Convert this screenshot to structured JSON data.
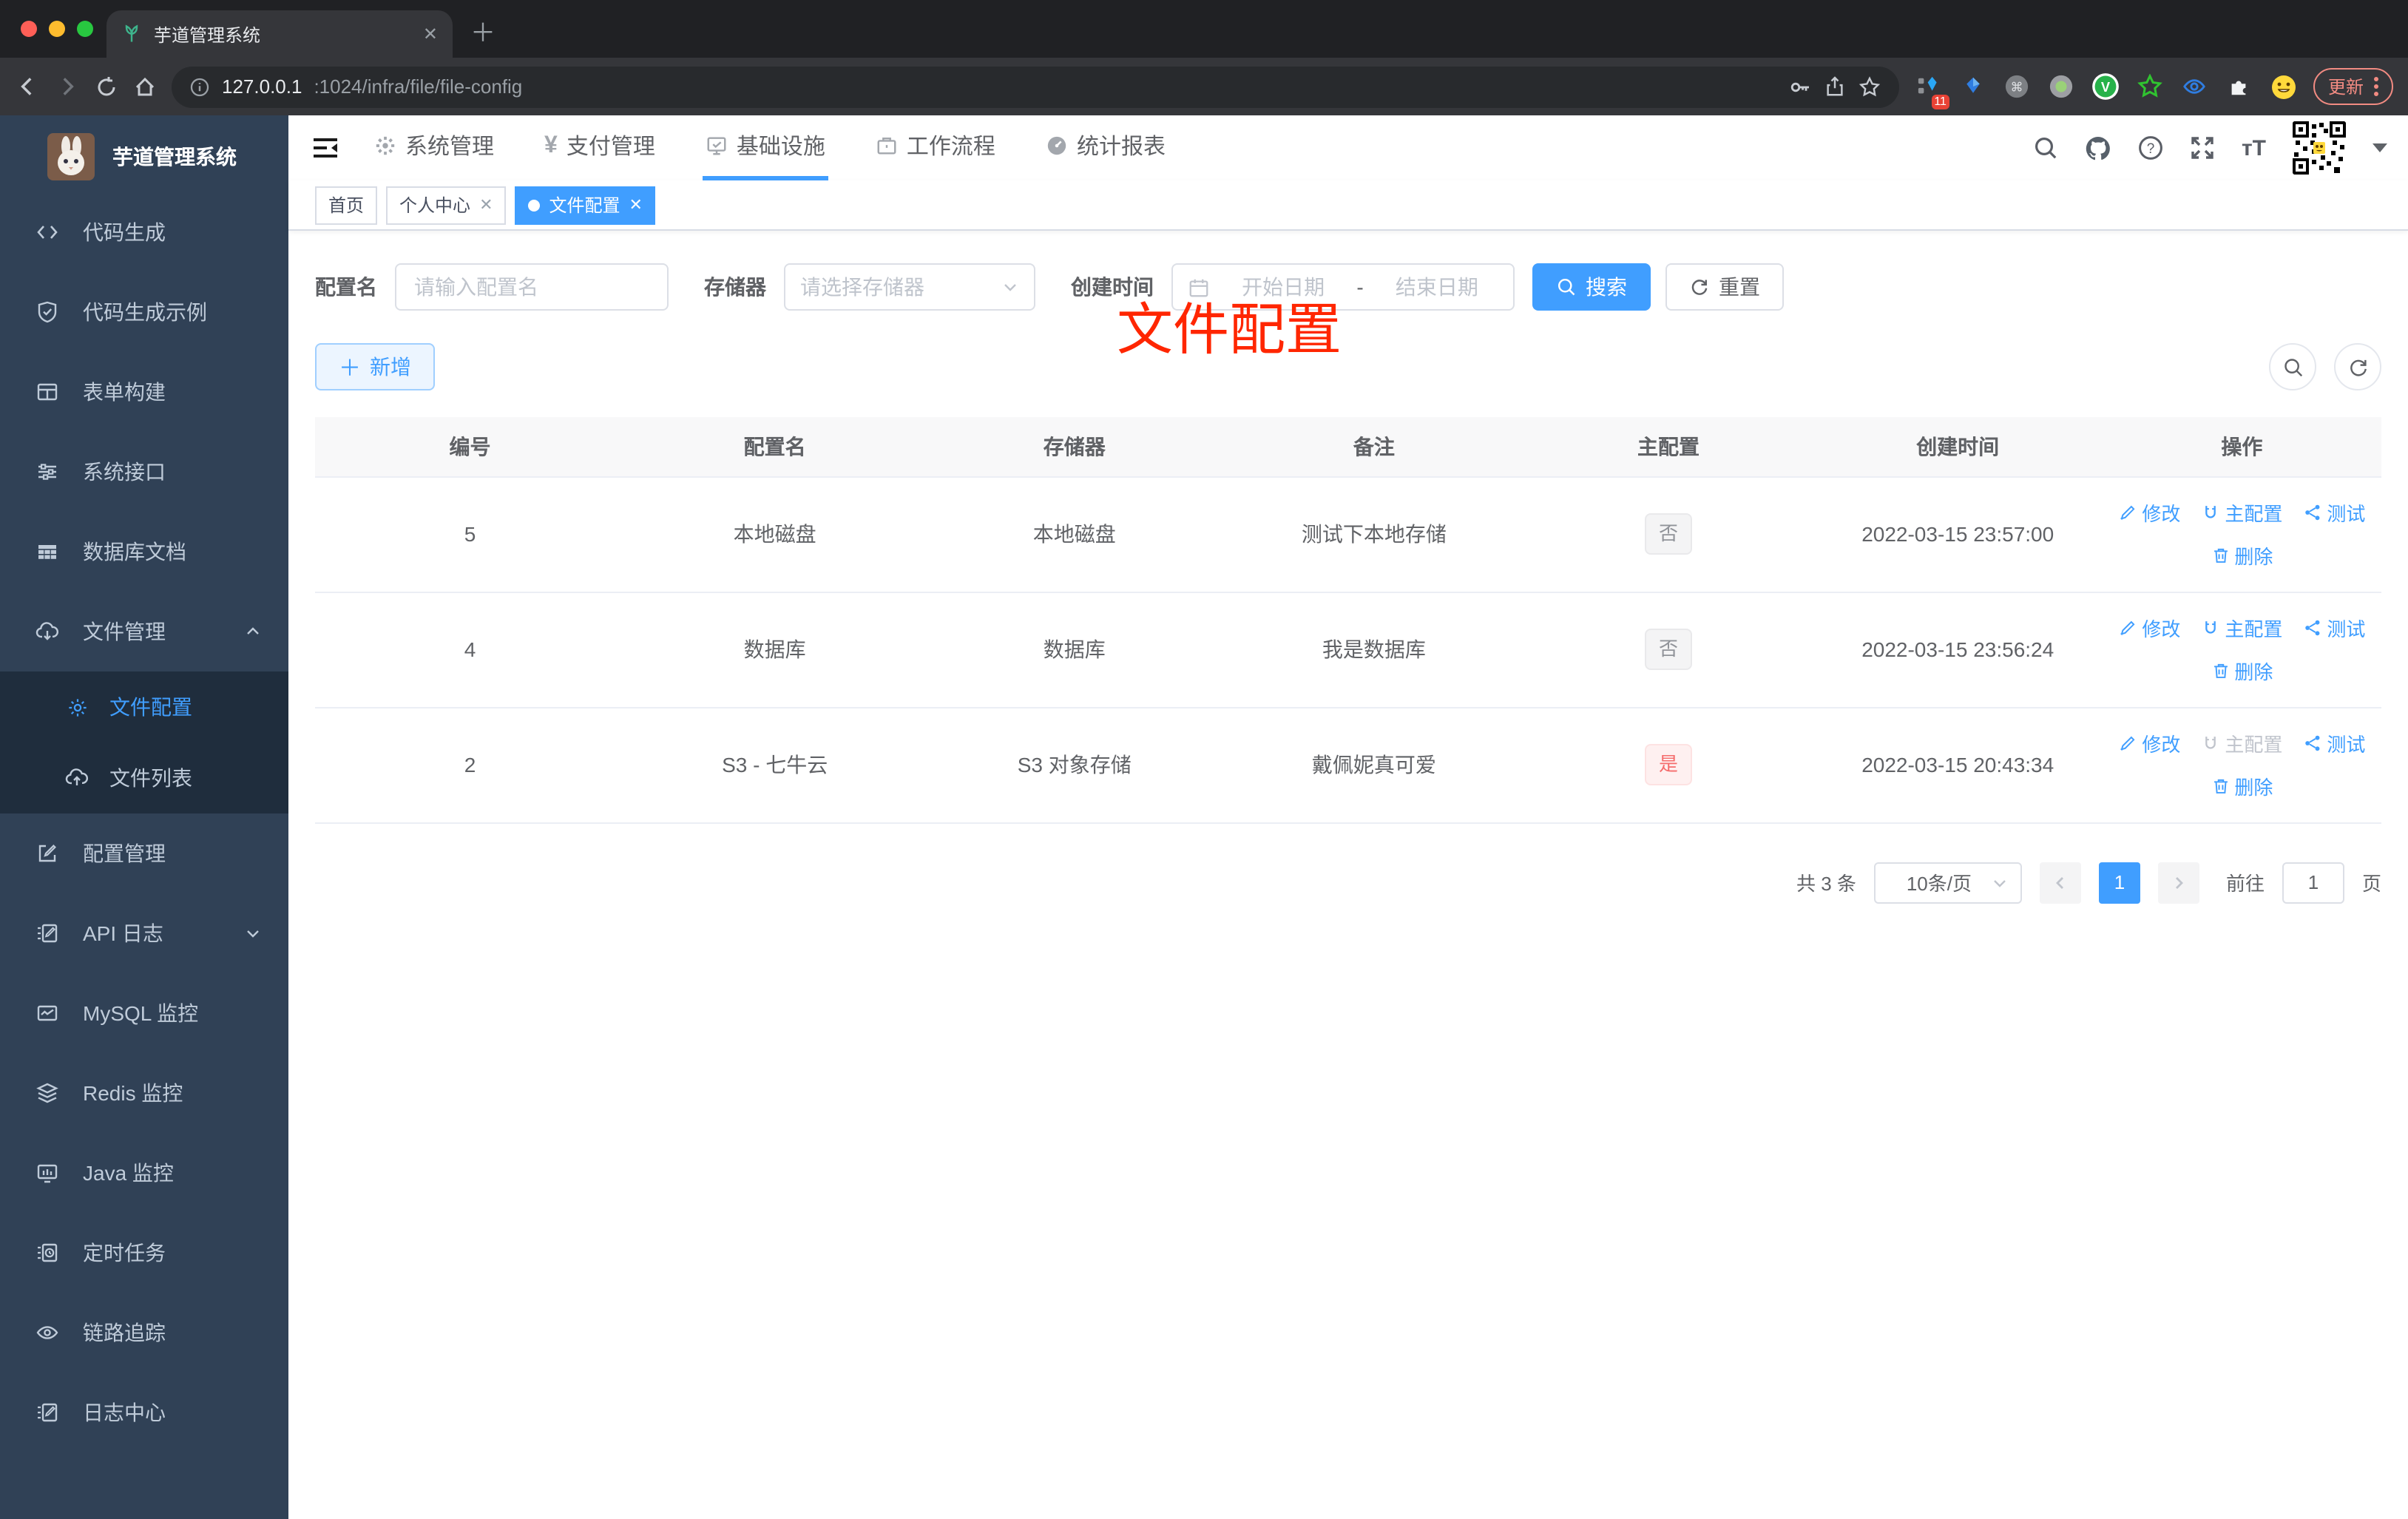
{
  "browser": {
    "tab_title": "芋道管理系统",
    "url_host": "127.0.0.1",
    "url_rest": ":1024/infra/file/file-config",
    "ext_badge": "11",
    "update_label": "更新"
  },
  "sidebar": {
    "logo_title": "芋道管理系统",
    "items": [
      {
        "label": "代码生成",
        "icon": "code-icon"
      },
      {
        "label": "代码生成示例",
        "icon": "shield-check-icon"
      },
      {
        "label": "表单构建",
        "icon": "form-builder-icon"
      },
      {
        "label": "系统接口",
        "icon": "sliders-icon"
      },
      {
        "label": "数据库文档",
        "icon": "database-doc-icon"
      },
      {
        "label": "文件管理",
        "icon": "cloud-download-icon",
        "expanded": true
      },
      {
        "label": "文件配置",
        "icon": "gear-icon",
        "active": true
      },
      {
        "label": "文件列表",
        "icon": "cloud-upload-icon"
      },
      {
        "label": "配置管理",
        "icon": "edit-square-icon"
      },
      {
        "label": "API 日志",
        "icon": "log-doc-icon",
        "collapsed": true
      },
      {
        "label": "MySQL 监控",
        "icon": "chart-monitor-icon"
      },
      {
        "label": "Redis 监控",
        "icon": "layers-icon"
      },
      {
        "label": "Java 监控",
        "icon": "java-monitor-icon"
      },
      {
        "label": "定时任务",
        "icon": "schedule-icon"
      },
      {
        "label": "链路追踪",
        "icon": "trace-eye-icon"
      },
      {
        "label": "日志中心",
        "icon": "log-center-icon"
      }
    ]
  },
  "header": {
    "nav": [
      {
        "label": "系统管理",
        "icon": "gear-icon"
      },
      {
        "label": "支付管理",
        "icon": "yen-icon"
      },
      {
        "label": "基础设施",
        "icon": "infra-monitor-icon",
        "active": true
      },
      {
        "label": "工作流程",
        "icon": "briefcase-icon"
      },
      {
        "label": "统计报表",
        "icon": "dashboard-icon"
      }
    ]
  },
  "tabs": [
    {
      "label": "首页"
    },
    {
      "label": "个人中心",
      "closable": true
    },
    {
      "label": "文件配置",
      "active": true,
      "closable": true
    }
  ],
  "annotation": "文件配置",
  "filters": {
    "name_label": "配置名",
    "name_placeholder": "请输入配置名",
    "storage_label": "存储器",
    "storage_placeholder": "请选择存储器",
    "time_label": "创建时间",
    "start_placeholder": "开始日期",
    "range_separator": "-",
    "end_placeholder": "结束日期",
    "search_label": "搜索",
    "reset_label": "重置"
  },
  "toolbar": {
    "add_label": "新增"
  },
  "table": {
    "columns": [
      "编号",
      "配置名",
      "存储器",
      "备注",
      "主配置",
      "创建时间",
      "操作"
    ],
    "row_actions": {
      "edit": "修改",
      "master": "主配置",
      "test": "测试",
      "remove": "删除"
    },
    "rows": [
      {
        "id": "5",
        "name": "本地磁盘",
        "storage": "本地磁盘",
        "remark": "测试下本地存储",
        "master_label": "否",
        "master_type": "info",
        "created": "2022-03-15 23:57:00",
        "master_disabled": false
      },
      {
        "id": "4",
        "name": "数据库",
        "storage": "数据库",
        "remark": "我是数据库",
        "master_label": "否",
        "master_type": "info",
        "created": "2022-03-15 23:56:24",
        "master_disabled": false
      },
      {
        "id": "2",
        "name": "S3 - 七牛云",
        "storage": "S3 对象存储",
        "remark": "戴佩妮真可爱",
        "master_label": "是",
        "master_type": "danger",
        "created": "2022-03-15 20:43:34",
        "master_disabled": true
      }
    ]
  },
  "pagination": {
    "total": "共 3 条",
    "page_size": "10条/页",
    "current_page": "1",
    "goto_label": "前往",
    "goto_value": "1",
    "unit_label": "页"
  },
  "colors": {
    "accent": "#409eff",
    "danger": "#f56c6c",
    "sidebar_bg": "#304156",
    "submenu_bg": "#1f2d3d",
    "annotation": "#ff2600",
    "chrome_bg": "#202124",
    "toolbar_bg": "#35363a"
  }
}
